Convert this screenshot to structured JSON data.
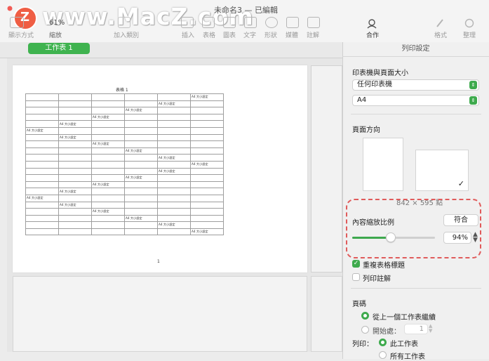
{
  "watermark": {
    "logo_letter": "Z",
    "text": "www.MacZ.com"
  },
  "window": {
    "title": "未命名3 — 已編輯"
  },
  "toolbar": {
    "items": [
      {
        "label": "顯示方式"
      },
      {
        "label": "縮放",
        "value": "61%"
      },
      {
        "label": "加入類別"
      },
      {
        "label": "插入"
      },
      {
        "label": "表格"
      },
      {
        "label": "圖表"
      },
      {
        "label": "文字"
      },
      {
        "label": "形狀"
      },
      {
        "label": "媒體"
      },
      {
        "label": "註解"
      },
      {
        "label": "合作"
      },
      {
        "label": "格式"
      },
      {
        "label": "整理"
      }
    ]
  },
  "sheet_tab": {
    "label": "工作表 1"
  },
  "page": {
    "table_title": "表格 1",
    "cell_text": "A4 大小設定",
    "page_number": "1"
  },
  "panel": {
    "header": "列印設定",
    "printer_section": "印表機與頁面大小",
    "printer_value": "任何印表機",
    "paper_value": "A4",
    "orientation_label": "頁面方向",
    "orientation_selected": "landscape",
    "dimensions": "842 × 595 點",
    "scale_label": "內容縮放比例",
    "fit_button": "符合",
    "scale_value": "94%",
    "scale_fraction": 0.47,
    "repeat_headers": {
      "label": "重複表格標題",
      "checked": true
    },
    "print_comments": {
      "label": "列印註解",
      "checked": false
    },
    "page_numbers_label": "頁碼",
    "continue_option": {
      "label": "從上一個工作表繼續",
      "selected": true
    },
    "start_at_option": {
      "label": "開始處：",
      "selected": false,
      "value": "1"
    },
    "print_label": "列印：",
    "this_sheet_option": {
      "label": "此工作表",
      "selected": true
    },
    "all_sheets_option": {
      "label": "所有工作表",
      "selected": false
    }
  },
  "colors": {
    "accent": "#3eaa4d",
    "highlight": "#e05b5b"
  }
}
